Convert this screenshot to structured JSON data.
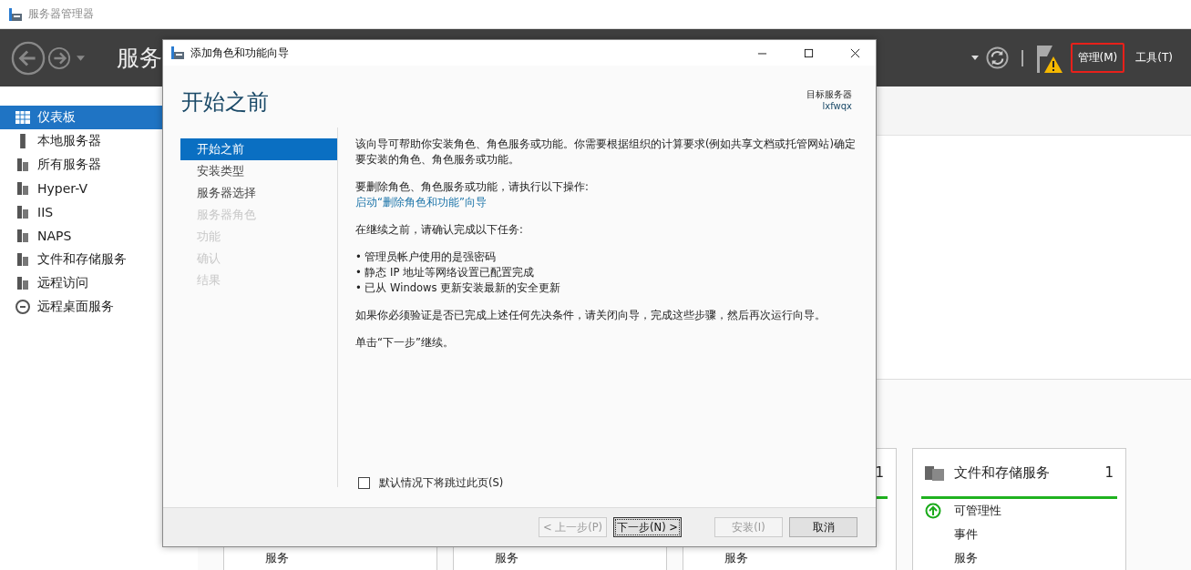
{
  "window": {
    "title": "服务器管理器"
  },
  "header": {
    "title": "服务",
    "menus": [
      {
        "label": "管理(M)",
        "highlighted": true
      },
      {
        "label": "工具(T)",
        "highlighted": false
      }
    ]
  },
  "sidebar": {
    "items": [
      {
        "label": "仪表板",
        "selected": true
      },
      {
        "label": "本地服务器",
        "selected": false
      },
      {
        "label": "所有服务器",
        "selected": false
      },
      {
        "label": "Hyper-V",
        "selected": false
      },
      {
        "label": "IIS",
        "selected": false
      },
      {
        "label": "NAPS",
        "selected": false
      },
      {
        "label": "文件和存储服务",
        "selected": false
      },
      {
        "label": "远程访问",
        "selected": false
      },
      {
        "label": "远程桌面服务",
        "selected": false
      }
    ]
  },
  "tiles": [
    {
      "rows": [
        "服务"
      ]
    },
    {
      "rows": [
        "服务"
      ]
    },
    {
      "count": "1",
      "rows": [
        "服务"
      ]
    },
    {
      "title": "文件和存储服务",
      "count": "1",
      "status": "可管理性",
      "rows": [
        "事件",
        "服务"
      ]
    }
  ],
  "dialog": {
    "title": "添加角色和功能向导",
    "heading": "开始之前",
    "target_label": "目标服务器",
    "target_value": "lxfwqx",
    "steps": [
      {
        "label": "开始之前",
        "selected": true,
        "disabled": false
      },
      {
        "label": "安装类型",
        "selected": false,
        "disabled": false
      },
      {
        "label": "服务器选择",
        "selected": false,
        "disabled": false
      },
      {
        "label": "服务器角色",
        "selected": false,
        "disabled": true
      },
      {
        "label": "功能",
        "selected": false,
        "disabled": true
      },
      {
        "label": "确认",
        "selected": false,
        "disabled": true
      },
      {
        "label": "结果",
        "selected": false,
        "disabled": true
      }
    ],
    "content": [
      {
        "kind": "text",
        "text": "该向导可帮助你安装角色、角色服务或功能。你需要根据组织的计算要求(例如共享文档或托管网站)确定要安装的角色、角色服务或功能。"
      },
      {
        "kind": "link",
        "text": "要删除角色、角色服务或功能，请执行以下操作:",
        "link": "启动“删除角色和功能”向导"
      },
      {
        "kind": "text",
        "text": "在继续之前，请确认完成以下任务:"
      },
      {
        "kind": "list",
        "bullet": "•",
        "items": [
          "管理员帐户使用的是强密码",
          "静态 IP 地址等网络设置已配置完成",
          "已从 Windows 更新安装最新的安全更新"
        ]
      },
      {
        "kind": "text",
        "text": "如果你必须验证是否已完成上述任何先决条件，请关闭向导，完成这些步骤，然后再次运行向导。"
      },
      {
        "kind": "text",
        "text": "单击“下一步”继续。"
      }
    ],
    "skip_page": {
      "label": "默认情况下将跳过此页(S)",
      "checked": false
    },
    "buttons": [
      {
        "label": "< 上一步(P)",
        "disabled": true,
        "default": false
      },
      {
        "label": "下一步(N) >",
        "disabled": false,
        "default": true
      },
      {
        "label": "安装(I)",
        "disabled": true,
        "default": false
      },
      {
        "label": "取消",
        "disabled": false,
        "default": false
      }
    ]
  }
}
